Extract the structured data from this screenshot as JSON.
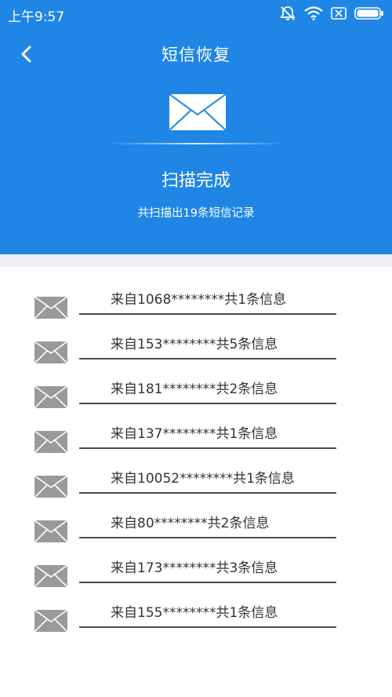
{
  "colors": {
    "primary": "#1f86e6",
    "divider": "#eef0f3",
    "icon_gray": "#9a9a9a"
  },
  "status_bar": {
    "time": "上午9:57",
    "icons": [
      "mute-icon",
      "wifi-icon",
      "no-sim-icon",
      "battery-icon"
    ]
  },
  "header": {
    "back_icon": "chevron-left-icon",
    "title": "短信恢复",
    "hero_icon": "envelope-icon",
    "scan_status": "扫描完成",
    "summary": "共扫描出19条短信记录"
  },
  "records": [
    {
      "label": "来自1068********共1条信息"
    },
    {
      "label": "来自153********共5条信息"
    },
    {
      "label": "来自181********共2条信息"
    },
    {
      "label": "来自137********共1条信息"
    },
    {
      "label": "来自10052********共1条信息"
    },
    {
      "label": "来自80********共2条信息"
    },
    {
      "label": "来自173********共3条信息"
    },
    {
      "label": "来自155********共1条信息"
    }
  ]
}
